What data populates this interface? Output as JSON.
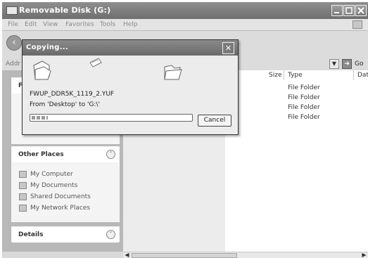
{
  "window": {
    "title": "Removable Disk (G:)"
  },
  "menu": {
    "items": [
      "File",
      "Edit",
      "View",
      "Favorites",
      "Tools",
      "Help"
    ]
  },
  "address": {
    "label": "Addr",
    "go_label": "Go"
  },
  "columns": {
    "size": "Size",
    "type": "Type",
    "date": "Date"
  },
  "files": [
    {
      "type": "File Folder"
    },
    {
      "type": "File Folder"
    },
    {
      "type": "File Folder"
    },
    {
      "type": "File Folder"
    }
  ],
  "left_panel_partial": {
    "header_letter": "F"
  },
  "other_places": {
    "title": "Other Places",
    "items": [
      {
        "label": "My Computer",
        "icon": "computer-icon"
      },
      {
        "label": "My Documents",
        "icon": "documents-folder-icon"
      },
      {
        "label": "Shared Documents",
        "icon": "shared-folder-icon"
      },
      {
        "label": "My Network Places",
        "icon": "network-icon"
      }
    ]
  },
  "details": {
    "title": "Details"
  },
  "dialog": {
    "title": "Copying...",
    "filename": "FWUP_DDR5K_1119_2.YUF",
    "from_to": "From 'Desktop' to 'G:\\'",
    "progress_fraction": 0.1,
    "cancel_label": "Cancel"
  }
}
